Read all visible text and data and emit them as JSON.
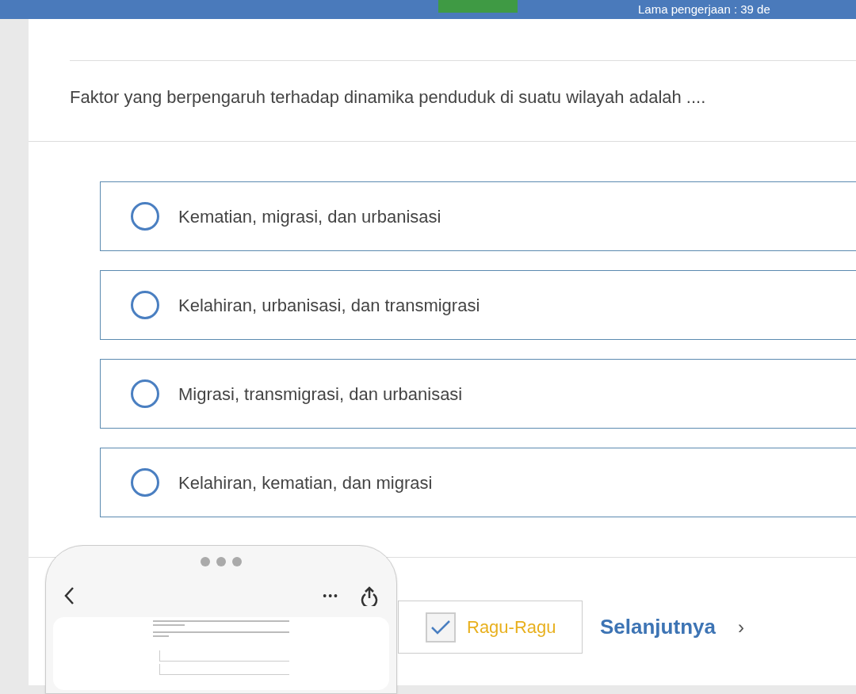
{
  "header": {
    "timer_text": "Lama pengerjaan : 39 de",
    "progress": {
      "level": 0.19
    }
  },
  "question": {
    "text": "Faktor yang berpengaruh terhadap dinamika penduduk di suatu wilayah adalah ...."
  },
  "options": [
    {
      "label": "Kematian, migrasi, dan urbanisasi",
      "selected": false
    },
    {
      "label": "Kelahiran, urbanisasi, dan transmigrasi",
      "selected": false
    },
    {
      "label": "Migrasi, transmigrasi, dan urbanisasi",
      "selected": false
    },
    {
      "label": "Kelahiran, kematian, dan migrasi",
      "selected": false
    }
  ],
  "footer": {
    "doubt": {
      "label": "Ragu-Ragu",
      "checked": true
    },
    "next": {
      "label": "Selanjutnya",
      "arrow": "›"
    }
  },
  "share_overlay": {
    "more": "•••"
  }
}
